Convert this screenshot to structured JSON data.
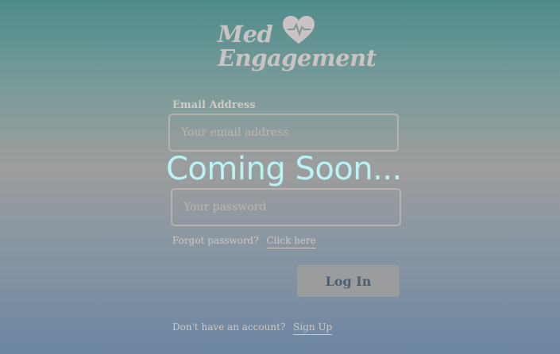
{
  "logo": {
    "line1": "Med",
    "line2": "Engagement"
  },
  "login": {
    "email_label": "Email Address",
    "email_placeholder": "Your email address",
    "password_placeholder": "Your password",
    "forgot_text": "Forgot password?",
    "forgot_link": "Click here",
    "login_button": "Log In",
    "signup_text": "Don't have an account?",
    "signup_link": "Sign Up"
  },
  "overlay": {
    "message": "Coming Soon..."
  },
  "colors": {
    "overlay_text": "#b9f4f4",
    "button_text": "#4d5e72",
    "button_bg": "#9a9c9e"
  },
  "icons": {
    "logo_heart": "heart-pulse-icon"
  }
}
